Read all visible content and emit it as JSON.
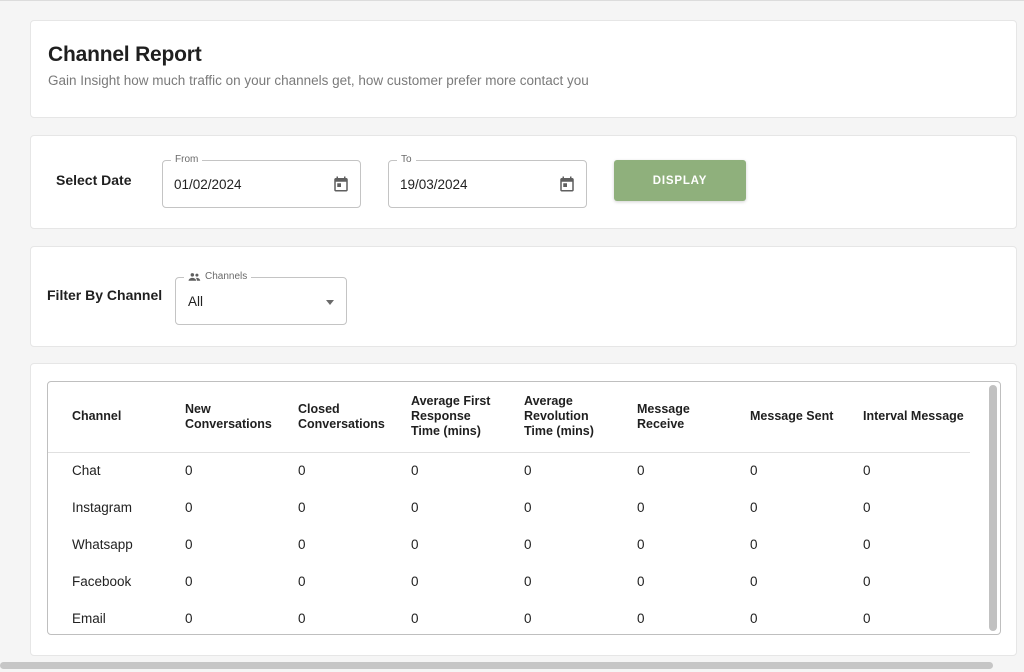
{
  "header": {
    "title": "Channel Report",
    "subtitle": "Gain Insight how much traffic on your channels get, how customer prefer more contact you"
  },
  "date_filter": {
    "label": "Select Date",
    "from": {
      "legend": "From",
      "value": "01/02/2024",
      "icon": "calendar-icon"
    },
    "to": {
      "legend": "To",
      "value": "19/03/2024",
      "icon": "calendar-icon"
    },
    "button_label": "DISPLAY",
    "button_color": "#8fb07c"
  },
  "channel_filter": {
    "label": "Filter By Channel",
    "legend": "Channels",
    "legend_icon": "people-icon",
    "value": "All"
  },
  "table": {
    "columns": [
      "Channel",
      "New Conversations",
      "Closed Conversations",
      "Average First Response Time (mins)",
      "Average Revolution Time (mins)",
      "Message Receive",
      "Message Sent",
      "Interval Message"
    ],
    "rows": [
      [
        "Chat",
        "0",
        "0",
        "0",
        "0",
        "0",
        "0",
        "0"
      ],
      [
        "Instagram",
        "0",
        "0",
        "0",
        "0",
        "0",
        "0",
        "0"
      ],
      [
        "Whatsapp",
        "0",
        "0",
        "0",
        "0",
        "0",
        "0",
        "0"
      ],
      [
        "Facebook",
        "0",
        "0",
        "0",
        "0",
        "0",
        "0",
        "0"
      ],
      [
        "Email",
        "0",
        "0",
        "0",
        "0",
        "0",
        "0",
        "0"
      ]
    ]
  }
}
